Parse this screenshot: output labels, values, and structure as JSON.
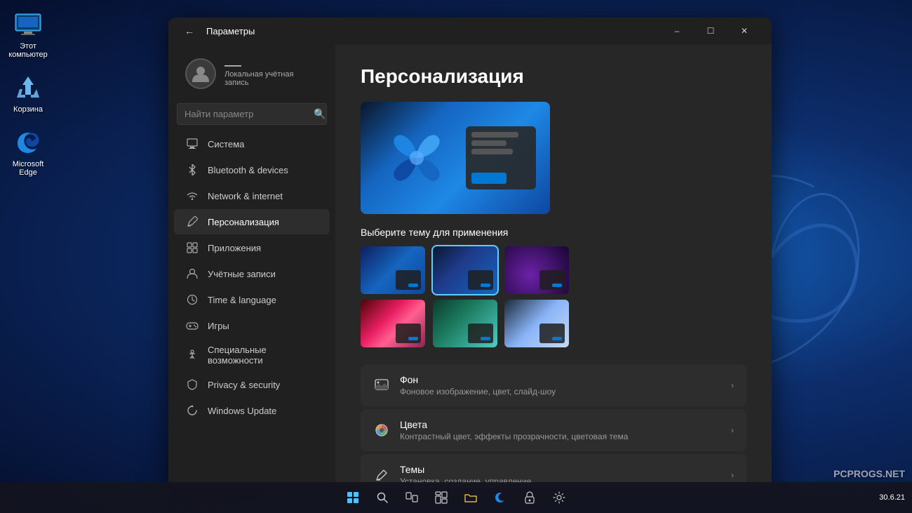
{
  "desktop": {
    "icons": [
      {
        "id": "computer",
        "label": "Этот\nкомпьютер",
        "symbol": "🖥"
      },
      {
        "id": "recycle",
        "label": "Корзина",
        "symbol": "🗑"
      },
      {
        "id": "edge",
        "label": "Microsoft\nEdge",
        "symbol": "🌐"
      }
    ]
  },
  "taskbar": {
    "icons": [
      "⊞",
      "🔍",
      "🗂",
      "⊞",
      "📁",
      "🌐",
      "🔒",
      "⚙"
    ],
    "time": "30.6.21",
    "watermark": "PCPROGS.NET"
  },
  "settings": {
    "window_title": "Параметры",
    "user": {
      "name": "——",
      "role": "Локальная учётная запись"
    },
    "search_placeholder": "Найти параметр",
    "nav_items": [
      {
        "id": "system",
        "label": "Система",
        "icon": "🖥"
      },
      {
        "id": "bluetooth",
        "label": "Bluetooth & devices",
        "icon": "🔵"
      },
      {
        "id": "network",
        "label": "Network & internet",
        "icon": "🌐"
      },
      {
        "id": "personalization",
        "label": "Персонализация",
        "icon": "✏️",
        "active": true
      },
      {
        "id": "apps",
        "label": "Приложения",
        "icon": "📦"
      },
      {
        "id": "accounts",
        "label": "Учётные записи",
        "icon": "👤"
      },
      {
        "id": "time",
        "label": "Time & language",
        "icon": "🕐"
      },
      {
        "id": "games",
        "label": "Игры",
        "icon": "🎮"
      },
      {
        "id": "accessibility",
        "label": "Специальные возможности",
        "icon": "♿"
      },
      {
        "id": "privacy",
        "label": "Privacy & security",
        "icon": "🔒"
      },
      {
        "id": "update",
        "label": "Windows Update",
        "icon": "⟳"
      }
    ],
    "page": {
      "title": "Персонализация",
      "theme_select_label": "Выберите тему для применения",
      "themes": [
        {
          "id": "t1",
          "class": "t1"
        },
        {
          "id": "t2",
          "class": "t2",
          "selected": true
        },
        {
          "id": "t3",
          "class": "t3"
        },
        {
          "id": "t4",
          "class": "t4"
        },
        {
          "id": "t5",
          "class": "t5"
        },
        {
          "id": "t6",
          "class": "t6"
        }
      ],
      "rows": [
        {
          "id": "background",
          "title": "Фон",
          "subtitle": "Фоновое изображение, цвет, слайд-шоу",
          "icon": "🖼"
        },
        {
          "id": "colors",
          "title": "Цвета",
          "subtitle": "Контрастный цвет, эффекты прозрачности, цветовая тема",
          "icon": "🎨"
        },
        {
          "id": "themes",
          "title": "Темы",
          "subtitle": "Установка, создание, управление",
          "icon": "✏️"
        }
      ]
    }
  }
}
